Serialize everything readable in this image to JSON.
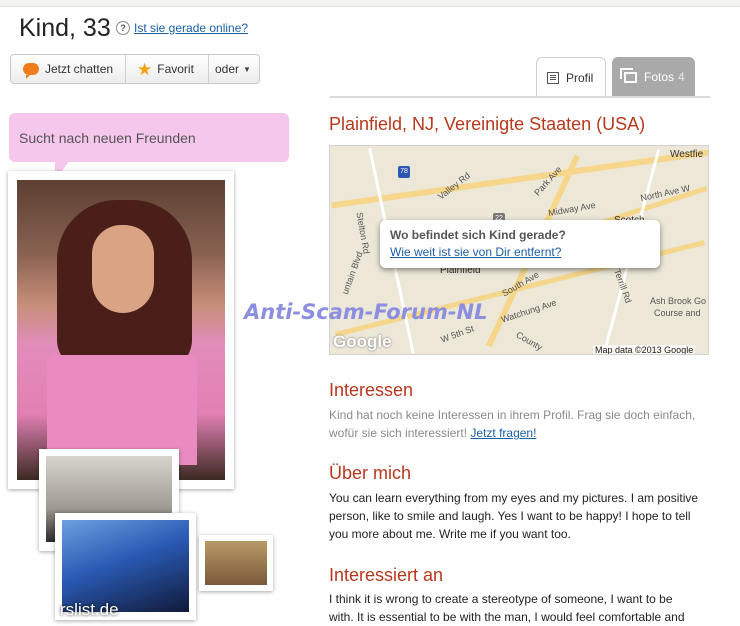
{
  "header": {
    "name_age": "Kind, 33",
    "help_glyph": "?",
    "online_link": "Ist sie gerade online?"
  },
  "actions": {
    "chat": "Jetzt chatten",
    "favorite": "Favorit",
    "more": "oder",
    "more_caret": "▼"
  },
  "tabs": {
    "profil": "Profil",
    "fotos": "Fotos",
    "fotos_count": "4"
  },
  "status": "Sucht nach neuen Freunden",
  "location": "Plainfield, NJ, Vereinigte Staaten (USA)",
  "map": {
    "popup_question": "Wo befindet sich Kind gerade?",
    "popup_link": "Wie weit ist sie von Dir entfernt?",
    "logo": "Google",
    "copyright": "Map data ©2013 Google",
    "labels": {
      "westfield": "Westfie",
      "park_ave": "Park Ave",
      "north_ave": "North Ave W",
      "valley_rd": "Valley Rd",
      "midway_ave": "Midway Ave",
      "scotch": "Scotch",
      "plainfield": "Plainfield",
      "south_ave": "South Ave",
      "watchung_ave": "Watchung Ave",
      "terrill_rd": "Terrill Rd",
      "ash_brook": "Ash Brook Go",
      "course": "Course and",
      "stelton": "Stelton Rd",
      "county": "County",
      "mountain": "untain Blvd",
      "w5th": "W 5th St",
      "route78": "78",
      "route22": "22"
    }
  },
  "watermark": "Anti-Scam-Forum-NL",
  "photo_watermark": "rslist.de",
  "sections": {
    "interessen_title": "Interessen",
    "interessen_text": "Kind hat noch keine Interessen in ihrem Profil. Frag sie doch einfach, wofür sie sich interessiert!",
    "interessen_link": "Jetzt fragen!",
    "ueber_title": "Über mich",
    "ueber_text": "You can learn everything from my eyes and my pictures. I am positive person, like to smile and laugh. Yes I want to be happy! I hope to tell you more about me. Write me if you want too.",
    "interessiert_title": "Interessiert an",
    "interessiert_text": "I think it is wrong to create a stereotype of someone, I want to be with. It is essential to be with the man, I would feel comfortable and"
  },
  "colors": {
    "accent": "#b8381c",
    "link": "#1b5fa8",
    "status_bg": "#f6c7ec",
    "tab_inactive": "#a9a9a9"
  },
  "icons": {
    "chat": "chat-bubble-icon",
    "favorite": "star-icon",
    "profil": "profile-card-icon",
    "fotos": "photos-stack-icon",
    "help": "question-circle-icon"
  }
}
